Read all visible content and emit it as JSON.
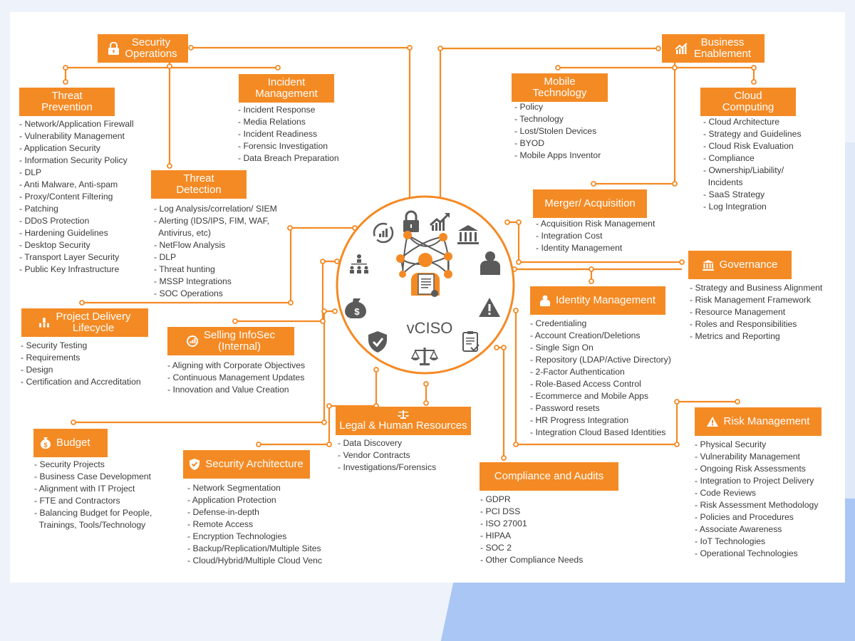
{
  "center": {
    "label": "vCISO"
  },
  "colors": {
    "accent": "#f48a24",
    "text": "#3a3a3a",
    "icon_gray": "#5a5a5a"
  },
  "ring_icons": [
    "cycle-chart-icon",
    "lock-icon",
    "growth-chart-icon",
    "bank-icon",
    "person-icon",
    "org-chart-icon",
    "warning-icon",
    "money-bag-icon",
    "clipboard-check-icon",
    "shield-check-icon",
    "scales-icon"
  ],
  "sections": {
    "security_operations": {
      "title": "Security\nOperations",
      "icon": "lock-icon"
    },
    "threat_prevention": {
      "title": "Threat\nPrevention",
      "items": [
        "Network/Application Firewall",
        "Vulnerability Management",
        "Application Security",
        "Information Security Policy",
        "DLP",
        "Anti Malware, Anti-spam",
        "Proxy/Content Filtering",
        "Patching",
        "DDoS Protection",
        "Hardening Guidelines",
        "Desktop Security",
        "Transport Layer Security",
        "Public Key Infrastructure"
      ]
    },
    "incident_management": {
      "title": "Incident\nManagement",
      "items": [
        "Incident Response",
        "Media Relations",
        "Incident Readiness",
        "Forensic Investigation",
        "Data Breach Preparation"
      ]
    },
    "threat_detection": {
      "title": "Threat\nDetection",
      "items": [
        "Log Analysis/correlation/  SIEM",
        "Alerting (IDS/IPS, FIM, WAF,",
        "Antivirus, etc)",
        "NetFlow Analysis",
        "DLP",
        "Threat hunting",
        "MSSP Integrations",
        "SOC Operations"
      ]
    },
    "business_enablement": {
      "title": "Business\nEnablement",
      "icon": "growth-chart-icon"
    },
    "mobile_technology": {
      "title": "Mobile\nTechnology",
      "items": [
        "Policy",
        "Technology",
        "Lost/Stolen Devices",
        "BYOD",
        "Mobile Apps Inventor"
      ]
    },
    "cloud_computing": {
      "title": "Cloud\nComputing",
      "items": [
        "Cloud Architecture",
        "Strategy and Guidelines",
        "Cloud Risk Evaluation",
        "Compliance",
        "Ownership/Liability/",
        "Incidents",
        "SaaS Strategy",
        "Log Integration"
      ]
    },
    "merger_acquisition": {
      "title": "Merger/ Acquisition",
      "items": [
        "Acquisition Risk Management",
        "Integration Cost",
        "Identity Management"
      ]
    },
    "governance": {
      "title": "Governance",
      "icon": "bank-icon",
      "items": [
        "Strategy and Business Alignment",
        "Risk Management Framework",
        "Resource Management",
        "Roles and Responsibilities",
        "Metrics and Reporting"
      ]
    },
    "identity_management": {
      "title": "Identity Management",
      "icon": "person-icon",
      "items": [
        "Credentialing",
        "Account Creation/Deletions",
        "Single Sign On",
        "Repository (LDAP/Active Directory)",
        "2-Factor Authentication",
        "Role-Based Access Control",
        "Ecommerce and Mobile Apps",
        "Password resets",
        "HR Progress Integration",
        "Integration Cloud Based Identities"
      ]
    },
    "project_delivery": {
      "title": "Project Delivery\nLifecycle",
      "icon": "org-chart-icon",
      "items": [
        "Security Testing",
        "Requirements",
        "Design",
        "Certification and Accreditation"
      ]
    },
    "selling_infosec": {
      "title": "Selling InfoSec\n(Internal)",
      "icon": "cycle-chart-icon",
      "items": [
        "Aligning with Corporate Objectives",
        "Continuous Management Updates",
        "Innovation and Value Creation"
      ]
    },
    "legal_hr": {
      "title": "Legal & Human Resources",
      "icon": "scales-icon",
      "items": [
        "Data Discovery",
        "Vendor Contracts",
        "Investigations/Forensics"
      ]
    },
    "budget": {
      "title": "Budget",
      "icon": "money-bag-icon",
      "items": [
        "Security Projects",
        "Business Case Development",
        "Alignment with IT Project",
        "FTE and Contractors",
        "Balancing Budget for People,",
        "Trainings, Tools/Technology"
      ]
    },
    "security_architecture": {
      "title": "Security Architecture",
      "icon": "shield-check-icon",
      "items": [
        "Network Segmentation",
        "Application Protection",
        "Defense-in-depth",
        "Remote Access",
        "Encryption Technologies",
        "Backup/Replication/Multiple Sites",
        "Cloud/Hybrid/Multiple Cloud Venc"
      ]
    },
    "compliance_audits": {
      "title": "Compliance and Audits",
      "items": [
        "GDPR",
        "PCI DSS",
        "ISO 27001",
        "HIPAA",
        "SOC 2",
        "Other Compliance Needs"
      ]
    },
    "risk_management": {
      "title": "Risk Management",
      "icon": "warning-icon",
      "items": [
        "Physical Security",
        "Vulnerability Management",
        "Ongoing Risk Assessments",
        "Integration to Project Delivery",
        "Code Reviews",
        "Risk Assessment Methodology",
        "Policies and Procedures",
        "Associate Awareness",
        "IoT Technologies",
        "Operational Technologies"
      ]
    }
  }
}
